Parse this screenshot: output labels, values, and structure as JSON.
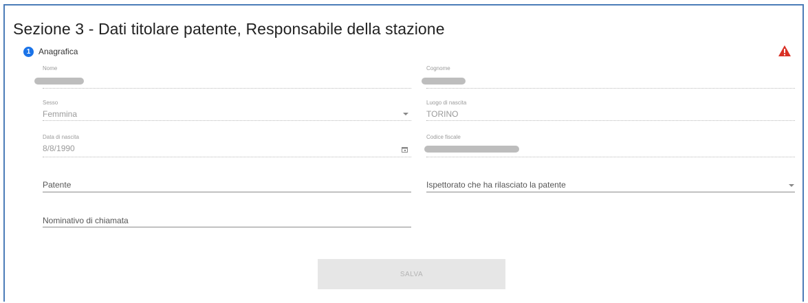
{
  "section": {
    "title": "Sezione 3 - Dati titolare patente, Responsabile della stazione",
    "step_number": "1",
    "step_label": "Anagrafica"
  },
  "fields": {
    "nome": {
      "label": "Nome",
      "value": ""
    },
    "cognome": {
      "label": "Cognome",
      "value": ""
    },
    "sesso": {
      "label": "Sesso",
      "value": "Femmina"
    },
    "luogo_nascita": {
      "label": "Luogo di nascita",
      "value": "TORINO"
    },
    "data_nascita": {
      "label": "Data di nascita",
      "value": "8/8/1990"
    },
    "codice_fiscale": {
      "label": "Codice fiscale",
      "value": ""
    },
    "patente": {
      "placeholder": "Patente"
    },
    "ispettorato": {
      "placeholder": "Ispettorato che ha rilasciato la patente"
    },
    "nominativo": {
      "placeholder": "Nominativo di chiamata"
    }
  },
  "actions": {
    "save_label": "SALVA"
  },
  "colors": {
    "frame": "#4a7bb7",
    "step_badge": "#1a73e8",
    "warning": "#d93025",
    "button_disabled": "#e6e6e6"
  }
}
